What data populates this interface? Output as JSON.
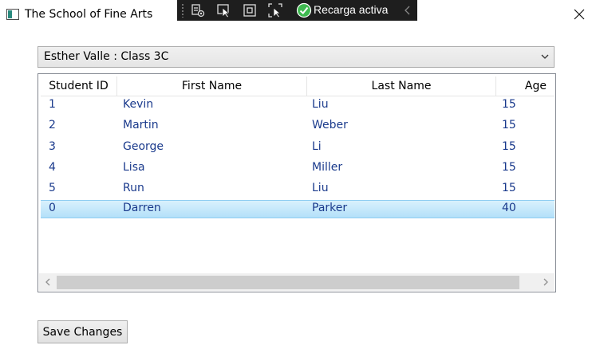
{
  "window": {
    "title": "The School of Fine Arts"
  },
  "devbar": {
    "hot_reload_label": "Recarga activa"
  },
  "class_selector": {
    "selected": "Esther Valle : Class 3C"
  },
  "grid": {
    "columns": [
      "Student ID",
      "First Name",
      "Last Name",
      "Age"
    ],
    "rows": [
      [
        "1",
        "Kevin",
        "Liu",
        "15"
      ],
      [
        "2",
        "Martin",
        "Weber",
        "15"
      ],
      [
        "3",
        "George",
        "Li",
        "15"
      ],
      [
        "4",
        "Lisa",
        "Miller",
        "15"
      ],
      [
        "5",
        "Run",
        "Liu",
        "15"
      ],
      [
        "0",
        "Darren",
        "Parker",
        "40"
      ]
    ],
    "selected_row": 5
  },
  "actions": {
    "save_label": "Save Changes"
  },
  "colors": {
    "cell_text": "#1a3a8c",
    "selection": "#b3e0f9",
    "devbar_bg": "#1e1e1e",
    "hot_reload_check": "#3fb950"
  }
}
